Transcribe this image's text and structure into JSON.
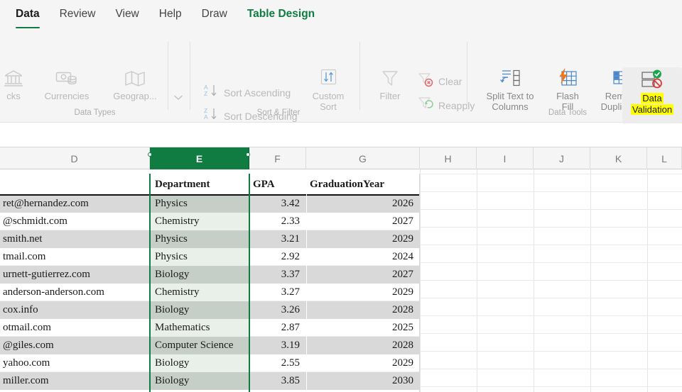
{
  "tabs": [
    {
      "label": "Data",
      "state": "active"
    },
    {
      "label": "Review",
      "state": "normal"
    },
    {
      "label": "View",
      "state": "normal"
    },
    {
      "label": "Help",
      "state": "normal"
    },
    {
      "label": "Draw",
      "state": "normal"
    },
    {
      "label": "Table Design",
      "state": "contextual"
    }
  ],
  "ribbon": {
    "groups": [
      {
        "name": "data-types",
        "label": "Data Types"
      },
      {
        "name": "sort-filter",
        "label": "Sort & Filter"
      },
      {
        "name": "data-tools",
        "label": "Data Tools"
      }
    ],
    "data_types": {
      "stocks": "cks",
      "currencies": "Currencies",
      "geography": "Geograp...",
      "expand": "˅"
    },
    "sort_filter": {
      "sort_ascending": "Sort Ascending",
      "sort_descending": "Sort Descending",
      "custom_sort_line1": "Custom",
      "custom_sort_line2": "Sort",
      "filter": "Filter",
      "clear": "Clear",
      "reapply": "Reapply"
    },
    "data_tools": {
      "split_text_line1": "Split Text to",
      "split_text_line2": "Columns",
      "flash_fill_line1": "Flash",
      "flash_fill_line2": "Fill",
      "remove_dup_line1": "Remove",
      "remove_dup_line2": "Duplicates",
      "data_validation_line1": "Data",
      "data_validation_line2": "Validation"
    }
  },
  "colors": {
    "accent_green": "#107c41",
    "highlight_yellow": "#ffff00",
    "selected_col_fill": "#c5cfc7",
    "band_fill": "#e9f0ea",
    "row_band_gray": "#d9d9d9"
  },
  "sheet": {
    "column_headers": [
      "D",
      "E",
      "F",
      "G",
      "H",
      "I",
      "J",
      "K",
      "L"
    ],
    "selected_column": "E",
    "table_headers": {
      "D": "",
      "E": "Department",
      "F": "GPA",
      "G": "GraduationYear"
    },
    "rows": [
      {
        "D": "ret@hernandez.com",
        "E": "Physics",
        "F": "3.42",
        "G": "2026"
      },
      {
        "D": "@schmidt.com",
        "E": "Chemistry",
        "F": "2.33",
        "G": "2027"
      },
      {
        "D": "smith.net",
        "E": "Physics",
        "F": "3.21",
        "G": "2029"
      },
      {
        "D": "tmail.com",
        "E": "Physics",
        "F": "2.92",
        "G": "2024"
      },
      {
        "D": "urnett-gutierrez.com",
        "E": "Biology",
        "F": "3.37",
        "G": "2027"
      },
      {
        "D": "anderson-anderson.com",
        "E": "Chemistry",
        "F": "3.27",
        "G": "2029"
      },
      {
        "D": "cox.info",
        "E": "Biology",
        "F": "3.26",
        "G": "2028"
      },
      {
        "D": "otmail.com",
        "E": "Mathematics",
        "F": "2.87",
        "G": "2025"
      },
      {
        "D": "@giles.com",
        "E": "Computer Science",
        "F": "3.19",
        "G": "2028"
      },
      {
        "D": "yahoo.com",
        "E": "Biology",
        "F": "2.55",
        "G": "2029"
      },
      {
        "D": "miller.com",
        "E": "Biology",
        "F": "3.85",
        "G": "2030"
      }
    ]
  }
}
